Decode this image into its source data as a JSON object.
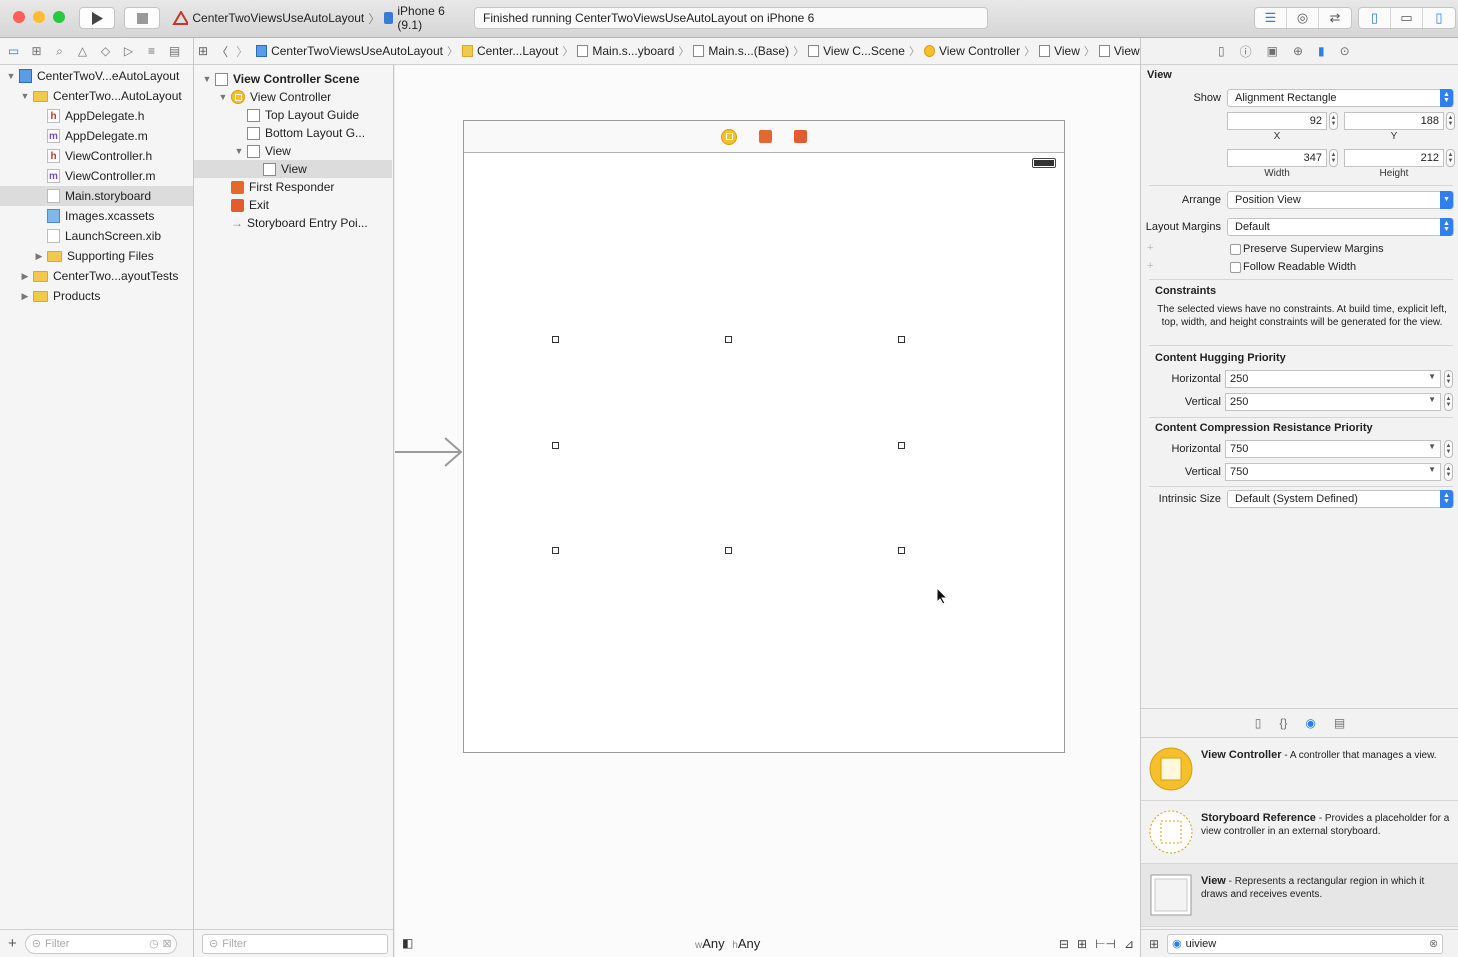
{
  "toolbar": {
    "scheme_target": "CenterTwoViewsUseAutoLayout",
    "destination": "iPhone 6 (9.1)",
    "activity_status": "Finished running CenterTwoViewsUseAutoLayout on iPhone 6",
    "traffic_colors": [
      "#ff5f57",
      "#febc2e",
      "#28c840"
    ]
  },
  "navigator": {
    "tree": [
      {
        "label": "CenterTwoV...eAutoLayout",
        "icon": "project",
        "indent": 0,
        "disclosure": "open"
      },
      {
        "label": "CenterTwo...AutoLayout",
        "icon": "folder",
        "indent": 1,
        "disclosure": "open"
      },
      {
        "label": "AppDelegate.h",
        "icon": "h",
        "indent": 2,
        "disclosure": ""
      },
      {
        "label": "AppDelegate.m",
        "icon": "m",
        "indent": 2,
        "disclosure": ""
      },
      {
        "label": "ViewController.h",
        "icon": "h",
        "indent": 2,
        "disclosure": ""
      },
      {
        "label": "ViewController.m",
        "icon": "m",
        "indent": 2,
        "disclosure": ""
      },
      {
        "label": "Main.storyboard",
        "icon": "storyboard",
        "indent": 2,
        "disclosure": "",
        "selected": true
      },
      {
        "label": "Images.xcassets",
        "icon": "assets",
        "indent": 2,
        "disclosure": ""
      },
      {
        "label": "LaunchScreen.xib",
        "icon": "storyboard",
        "indent": 2,
        "disclosure": ""
      },
      {
        "label": "Supporting Files",
        "icon": "folder",
        "indent": 2,
        "disclosure": "closed"
      },
      {
        "label": "CenterTwo...ayoutTests",
        "icon": "folder",
        "indent": 1,
        "disclosure": "closed"
      },
      {
        "label": "Products",
        "icon": "folder",
        "indent": 1,
        "disclosure": "closed"
      }
    ],
    "filter_placeholder": "Filter"
  },
  "jumpbar": {
    "items": [
      "CenterTwoViewsUseAutoLayout",
      "Center...Layout",
      "Main.s...yboard",
      "Main.s...(Base)",
      "View C...Scene",
      "View Controller",
      "View",
      "View"
    ]
  },
  "outline": {
    "rows": [
      {
        "label": "View Controller Scene",
        "icon": "scene",
        "indent": 0,
        "disclosure": "open",
        "bold": true
      },
      {
        "label": "View Controller",
        "icon": "vc",
        "indent": 1,
        "disclosure": "open"
      },
      {
        "label": "Top Layout Guide",
        "icon": "box",
        "indent": 2,
        "disclosure": ""
      },
      {
        "label": "Bottom Layout G...",
        "icon": "box",
        "indent": 2,
        "disclosure": ""
      },
      {
        "label": "View",
        "icon": "box",
        "indent": 2,
        "disclosure": "open"
      },
      {
        "label": "View",
        "icon": "box",
        "indent": 3,
        "disclosure": "",
        "selected": true
      },
      {
        "label": "First Responder",
        "icon": "cube",
        "indent": 1,
        "disclosure": ""
      },
      {
        "label": "Exit",
        "icon": "exit",
        "indent": 1,
        "disclosure": ""
      },
      {
        "label": "Storyboard Entry Poi...",
        "icon": "arrow",
        "indent": 1,
        "disclosure": ""
      }
    ],
    "filter_placeholder": "Filter"
  },
  "canvas": {
    "size_class_w_prefix": "w",
    "size_class_w": "Any",
    "size_class_h_prefix": "h",
    "size_class_h": "Any"
  },
  "inspector": {
    "title": "View",
    "show_label": "Show",
    "show_value": "Alignment Rectangle",
    "x": "92",
    "y": "188",
    "width": "347",
    "height": "212",
    "x_caption": "X",
    "y_caption": "Y",
    "width_caption": "Width",
    "height_caption": "Height",
    "arrange_label": "Arrange",
    "arrange_value": "Position View",
    "layout_margins_label": "Layout Margins",
    "layout_margins_value": "Default",
    "preserve_label": "Preserve Superview Margins",
    "readable_label": "Follow Readable Width",
    "constraints_title": "Constraints",
    "constraints_text": "The selected views have no constraints. At build time, explicit left, top, width, and height constraints will be generated for the view.",
    "hugging_title": "Content Hugging Priority",
    "hugging_h_label": "Horizontal",
    "hugging_h": "250",
    "hugging_v_label": "Vertical",
    "hugging_v": "250",
    "compression_title": "Content Compression Resistance Priority",
    "compression_h_label": "Horizontal",
    "compression_h": "750",
    "compression_v_label": "Vertical",
    "compression_v": "750",
    "intrinsic_label": "Intrinsic Size",
    "intrinsic_value": "Default (System Defined)"
  },
  "library": {
    "items": [
      {
        "title": "View Controller",
        "desc": " - A controller that manages a view."
      },
      {
        "title": "Storyboard Reference",
        "desc": " - Provides a placeholder for a view controller in an external storyboard."
      },
      {
        "title": "View",
        "desc": " - Represents a rectangular region in which it draws and receives events."
      }
    ],
    "search_value": "uiview"
  }
}
